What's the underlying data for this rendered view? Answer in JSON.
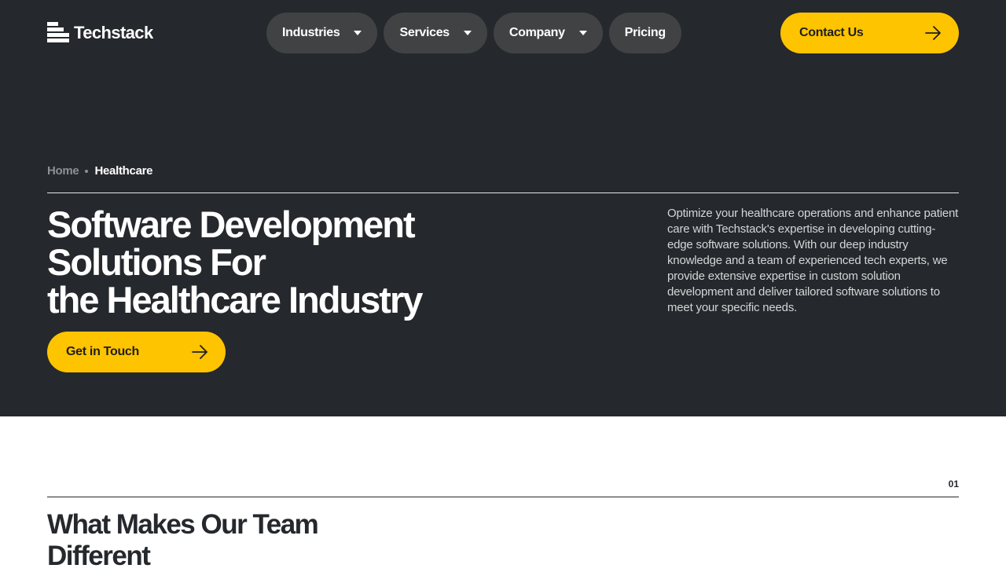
{
  "header": {
    "brand": "Techstack",
    "nav": [
      {
        "label": "Industries",
        "has_dropdown": true
      },
      {
        "label": "Services",
        "has_dropdown": true
      },
      {
        "label": "Company",
        "has_dropdown": true
      },
      {
        "label": "Pricing",
        "has_dropdown": false
      }
    ],
    "contact_label": "Contact Us"
  },
  "hero": {
    "breadcrumb": {
      "home": "Home",
      "current": "Healthcare"
    },
    "title_lines": [
      "Software Development",
      "Solutions For",
      "the Healthcare Industry"
    ],
    "cta_label": "Get in Touch",
    "description": "Optimize your healthcare operations and enhance patient care with Techstack's expertise in developing cutting-edge software solutions. With our deep industry knowledge and a team of experienced tech experts, we provide extensive expertise in custom solution development and deliver tailored software solutions to meet your specific needs."
  },
  "section": {
    "number": "01",
    "title": "What Makes Our Team Different"
  },
  "colors": {
    "hero_bg": "#25282c",
    "nav_pill": "#414244",
    "accent": "#ffc400",
    "page_bg": "#ffffff"
  },
  "icons": [
    "logo-icon",
    "chevron-down-icon",
    "arrow-right-icon"
  ]
}
